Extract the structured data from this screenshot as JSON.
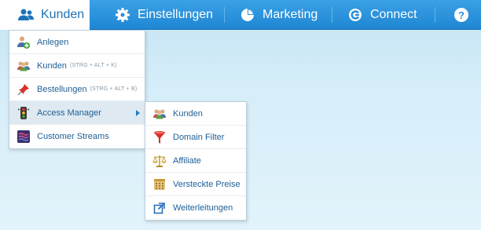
{
  "nav": {
    "kunden": "Kunden",
    "einstellungen": "Einstellungen",
    "marketing": "Marketing",
    "connect": "Connect",
    "help": "?"
  },
  "dropdown": {
    "items": [
      {
        "label": "Anlegen",
        "shortcut": ""
      },
      {
        "label": "Kunden",
        "shortcut": "(STRG + ALT + K)"
      },
      {
        "label": "Bestellungen",
        "shortcut": "(STRG + ALT + B)"
      },
      {
        "label": "Access Manager",
        "shortcut": ""
      },
      {
        "label": "Customer Streams",
        "shortcut": ""
      }
    ]
  },
  "submenu": {
    "items": [
      {
        "label": "Kunden"
      },
      {
        "label": "Domain Filter"
      },
      {
        "label": "Affiliate"
      },
      {
        "label": "Versteckte Preise"
      },
      {
        "label": "Weiterleitungen"
      }
    ]
  },
  "colors": {
    "topbar": "#2a93dd",
    "active_tab_text": "#1e73b8",
    "menu_text": "#1e5f96",
    "hover_row": "#dfe9f1"
  }
}
